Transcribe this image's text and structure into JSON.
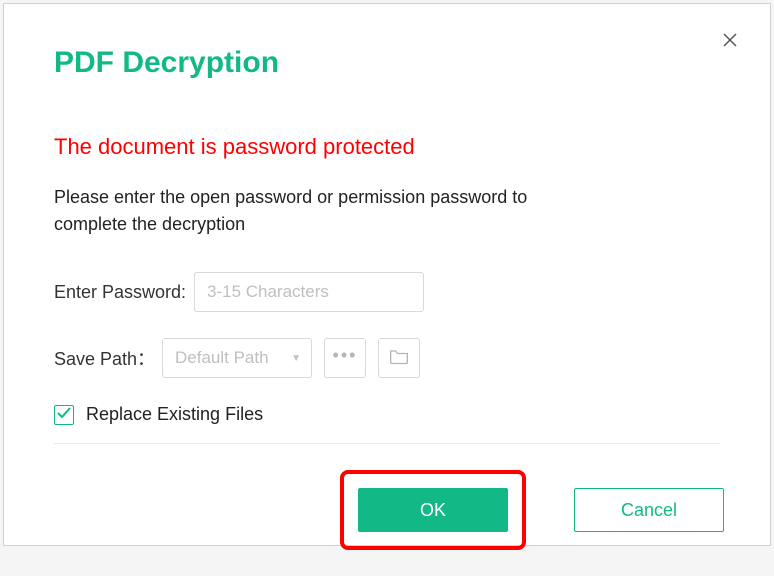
{
  "dialog": {
    "title": "PDF Decryption",
    "warning": "The document is password protected",
    "description": "Please enter the open password or permission password to complete the decryption"
  },
  "password": {
    "label": "Enter Password:",
    "placeholder": "3-15 Characters",
    "value": ""
  },
  "savePath": {
    "label": "Save Path：",
    "dropdownText": "Default Path"
  },
  "replace": {
    "label": "Replace Existing Files",
    "checked": true
  },
  "buttons": {
    "ok": "OK",
    "cancel": "Cancel"
  },
  "colors": {
    "accent": "#12b886",
    "danger": "#ff0000"
  }
}
